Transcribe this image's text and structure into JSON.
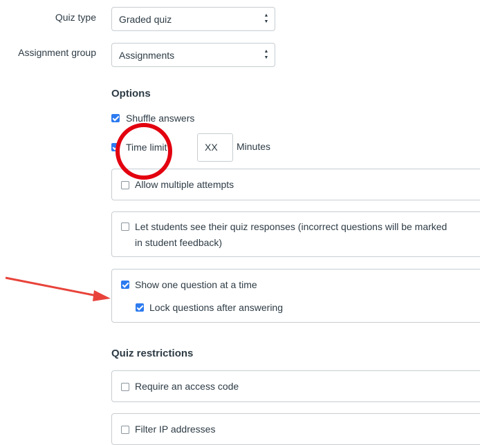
{
  "quiz_type": {
    "label": "Quiz type",
    "value": "Graded quiz"
  },
  "assignment_group": {
    "label": "Assignment group",
    "value": "Assignments"
  },
  "options": {
    "heading": "Options",
    "shuffle_answers": {
      "label": "Shuffle answers",
      "checked": true
    },
    "time_limit": {
      "label": "Time limit",
      "value": "XX",
      "unit": "Minutes",
      "checked": true
    },
    "multiple_attempts": {
      "label": "Allow multiple attempts",
      "checked": false
    },
    "see_responses": {
      "label_line1": "Let students see their quiz responses (incorrect questions will be marked",
      "label_line2": "in student feedback)",
      "checked": false
    },
    "one_question": {
      "label": "Show one question at a time",
      "checked": true
    },
    "lock_questions": {
      "label": "Lock questions after answering",
      "checked": true
    }
  },
  "restrictions": {
    "heading": "Quiz restrictions",
    "access_code": {
      "label": "Require an access code",
      "checked": false
    },
    "filter_ip": {
      "label": "Filter IP addresses",
      "checked": false
    }
  },
  "annotations": {
    "circle_color": "#e3000f",
    "arrow_color": "#e8433a"
  }
}
